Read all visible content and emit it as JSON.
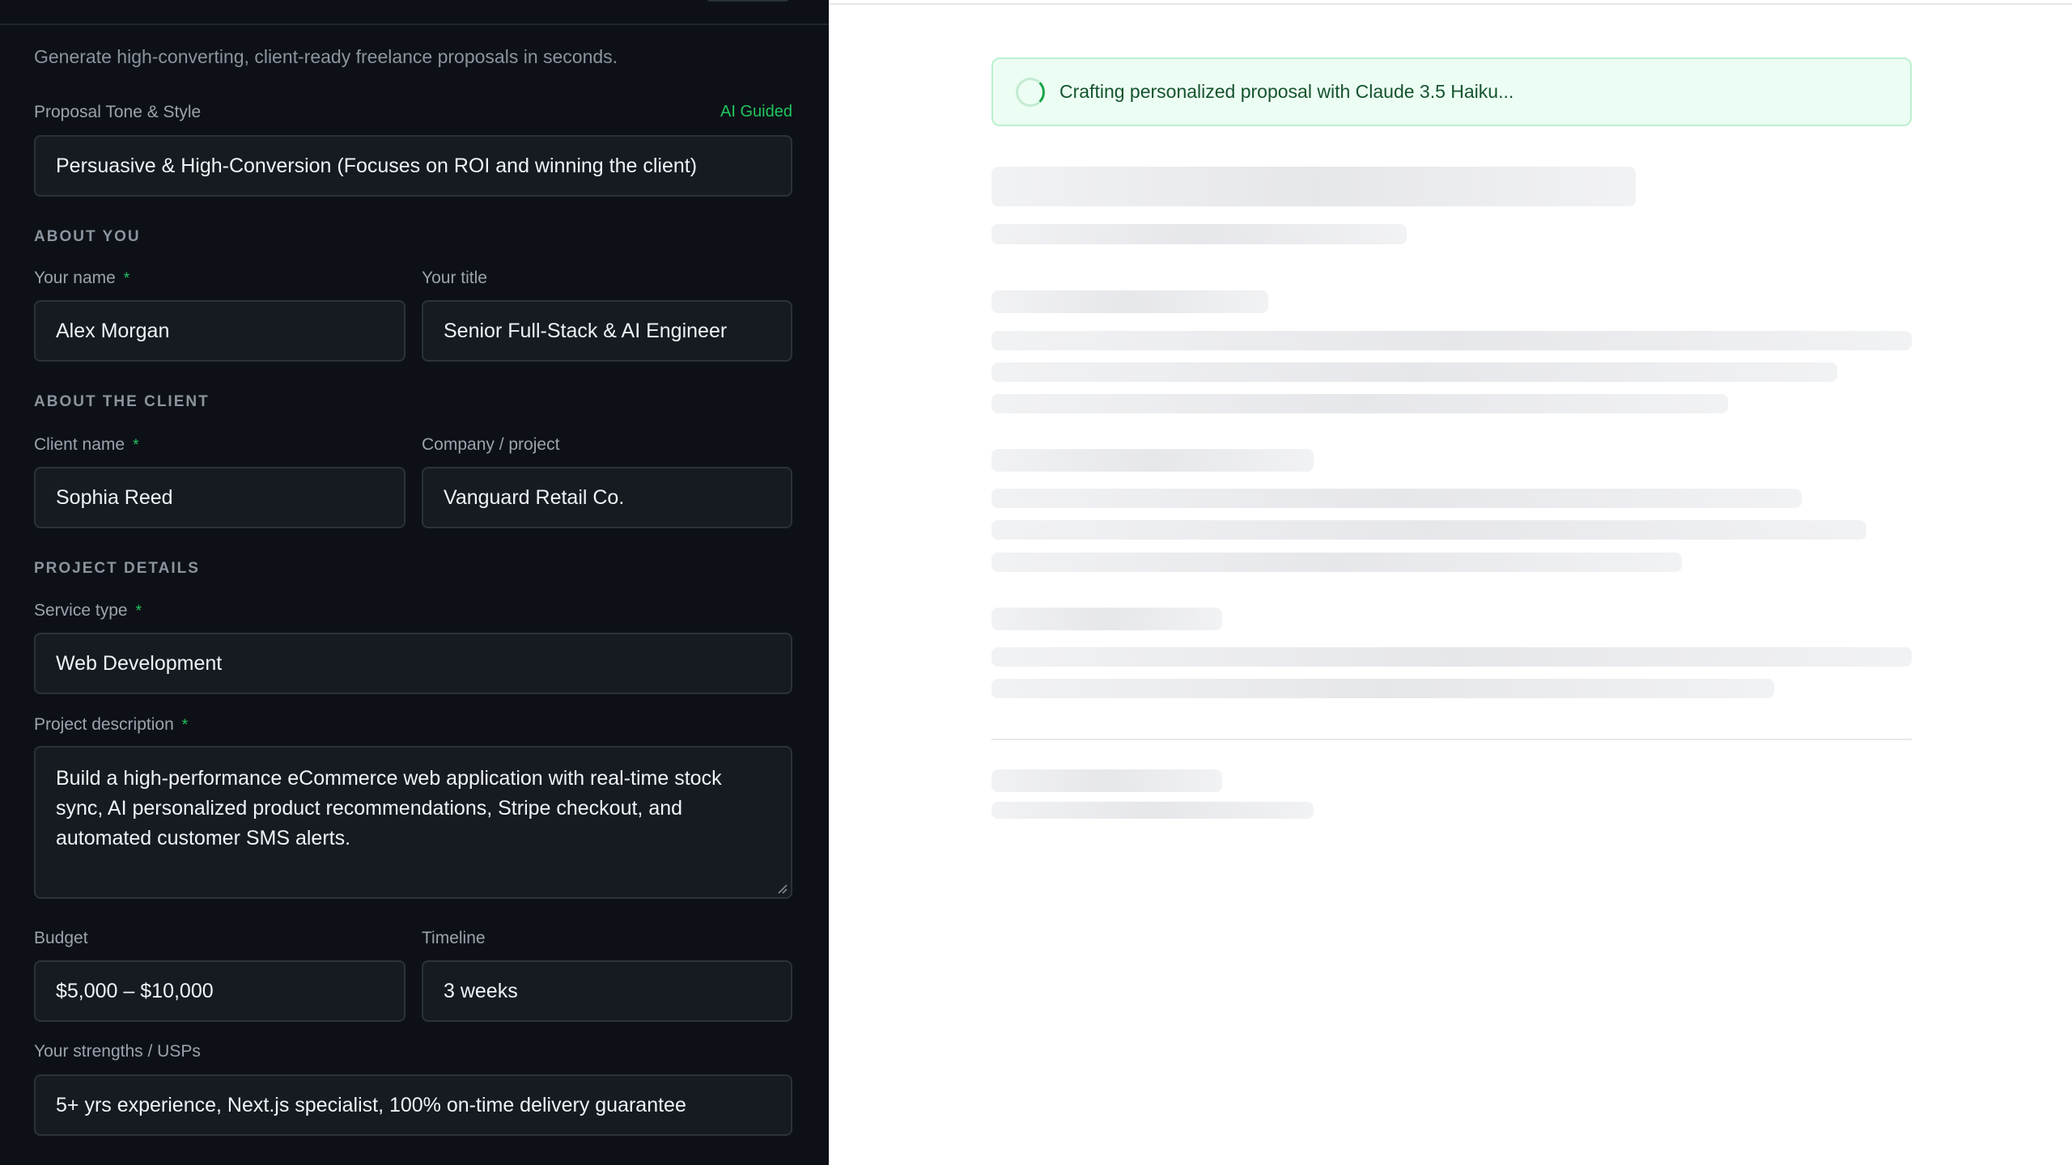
{
  "form": {
    "subtitle": "Generate high-converting, client-ready freelance proposals in seconds.",
    "tone": {
      "label": "Proposal Tone & Style",
      "badge": "AI Guided",
      "value": "Persuasive & High-Conversion (Focuses on ROI and winning the client)"
    },
    "about_you": {
      "heading": "ABOUT YOU",
      "name_label": "Your name",
      "name_value": "Alex Morgan",
      "title_label": "Your title",
      "title_value": "Senior Full-Stack & AI Engineer"
    },
    "about_client": {
      "heading": "ABOUT THE CLIENT",
      "client_label": "Client name",
      "client_value": "Sophia Reed",
      "company_label": "Company / project",
      "company_value": "Vanguard Retail Co."
    },
    "project": {
      "heading": "PROJECT DETAILS",
      "service_label": "Service type",
      "service_value": "Web Development",
      "description_label": "Project description",
      "description_lines": [
        "Build a high-performance eCommerce web application with real-time stock",
        "sync, AI personalized product recommendations, Stripe checkout, and",
        "automated customer SMS alerts."
      ],
      "budget_label": "Budget",
      "budget_value": "$5,000 – $10,000",
      "timeline_label": "Timeline",
      "timeline_value": "3 weeks",
      "strengths_label": "Your strengths / USPs",
      "strengths_value": "5+ yrs experience, Next.js specialist, 100% on-time delivery guarantee"
    },
    "required_marker": "*"
  },
  "output": {
    "status_text": "Crafting personalized proposal with Claude 3.5 Haiku...",
    "accent_color": "#16a34a"
  }
}
